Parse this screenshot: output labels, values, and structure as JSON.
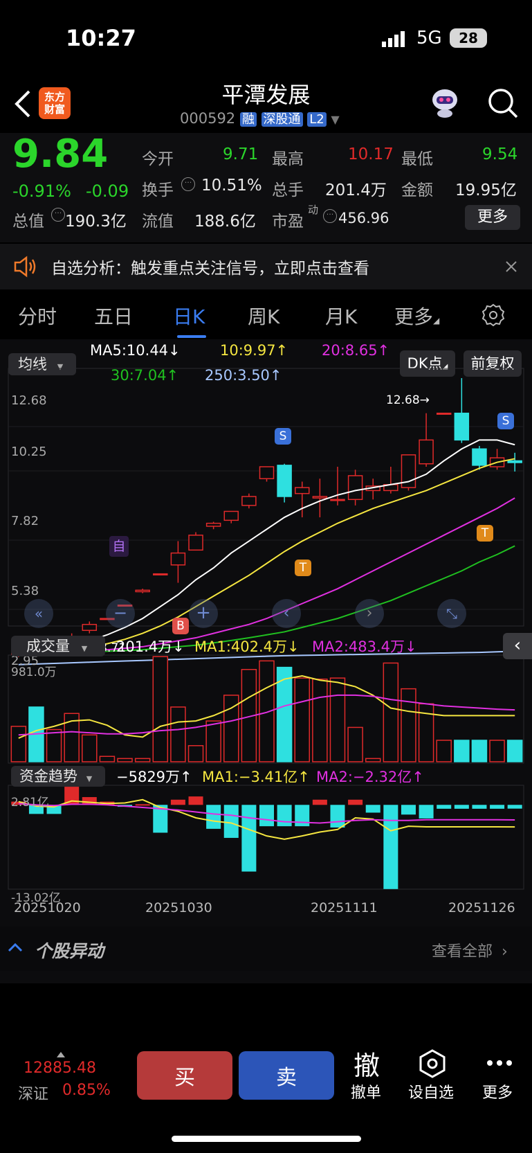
{
  "status_bar": {
    "time": "10:27",
    "network": "5G",
    "battery": "28"
  },
  "header": {
    "app_logo": "东方财富",
    "stock_name": "平潭发展",
    "stock_code": "000592",
    "tags": [
      "融",
      "深股通",
      "L2"
    ]
  },
  "quote": {
    "price": "9.84",
    "change_pct": "-0.91%",
    "change": "-0.09",
    "open_label": "今开",
    "open": "9.71",
    "high_label": "最高",
    "high": "10.17",
    "low_label": "最低",
    "low": "9.54",
    "turnover_label": "换手",
    "turnover": "10.51%",
    "volume_label": "总手",
    "volume": "201.4万",
    "amount_label": "金额",
    "amount": "19.95亿",
    "mktcap_label": "总值",
    "mktcap": "190.3亿",
    "float_label": "流值",
    "float": "188.6亿",
    "pe_label": "市盈",
    "pe_sup": "动",
    "pe": "456.96",
    "more_button": "更多"
  },
  "notice": {
    "text": "自选分析：触发重点关注信号，立即点击查看"
  },
  "tabs": {
    "items": [
      "分时",
      "五日",
      "日K",
      "周K",
      "月K",
      "更多"
    ],
    "active": 2
  },
  "ma_legend": {
    "selector": "均线",
    "ma5": "MA5:10.44↓",
    "ma10": "10:9.97↑",
    "ma20": "20:8.65↑",
    "ma30": "30:7.04↑",
    "ma250": "250:3.50↑",
    "dk_button": "DK点",
    "adjust_button": "前复权"
  },
  "colors": {
    "up": "#e02a2a",
    "down": "#2ee0e0",
    "ma5": "#ffffff",
    "ma10": "#f5e640",
    "ma20": "#e030e0",
    "ma30": "#20c020",
    "ma250": "#a8c8ff",
    "green_text": "#2bd52b"
  },
  "kline": {
    "y_ticks": [
      "12.68",
      "10.25",
      "7.82",
      "5.38",
      "2.95"
    ],
    "max_label": "12.68→",
    "min_label": "←3.71",
    "markers": {
      "zi": "自",
      "s": "S",
      "t": "T",
      "b": "B"
    },
    "candles": [
      {
        "o": 3.4,
        "c": 3.7,
        "h": 3.8,
        "l": 3.3
      },
      {
        "o": 3.6,
        "c": 3.5,
        "h": 3.75,
        "l": 3.4
      },
      {
        "o": 3.5,
        "c": 3.8,
        "h": 3.9,
        "l": 3.45
      },
      {
        "o": 3.8,
        "c": 4.0,
        "h": 4.1,
        "l": 3.75
      },
      {
        "o": 4.2,
        "c": 4.4,
        "h": 4.5,
        "l": 4.1
      },
      {
        "o": 4.6,
        "c": 4.6,
        "h": 4.6,
        "l": 4.6
      },
      {
        "o": 5.05,
        "c": 5.05,
        "h": 5.05,
        "l": 5.05
      },
      {
        "o": 5.5,
        "c": 5.55,
        "h": 5.6,
        "l": 5.45
      },
      {
        "o": 6.1,
        "c": 6.1,
        "h": 6.1,
        "l": 6.1
      },
      {
        "o": 6.4,
        "c": 6.8,
        "h": 7.2,
        "l": 5.8
      },
      {
        "o": 6.9,
        "c": 7.4,
        "h": 7.5,
        "l": 6.9
      },
      {
        "o": 7.7,
        "c": 7.8,
        "h": 7.85,
        "l": 7.6
      },
      {
        "o": 7.9,
        "c": 8.2,
        "h": 8.2,
        "l": 7.8
      },
      {
        "o": 8.4,
        "c": 8.7,
        "h": 8.8,
        "l": 8.3
      },
      {
        "o": 9.3,
        "c": 9.7,
        "h": 9.7,
        "l": 9.2
      },
      {
        "o": 9.75,
        "c": 8.7,
        "h": 9.8,
        "l": 8.5
      },
      {
        "o": 8.8,
        "c": 9.0,
        "h": 9.2,
        "l": 8.0
      },
      {
        "o": 8.65,
        "c": 8.7,
        "h": 9.3,
        "l": 8.0
      },
      {
        "o": 8.6,
        "c": 8.6,
        "h": 9.7,
        "l": 8.4
      },
      {
        "o": 8.6,
        "c": 9.4,
        "h": 9.6,
        "l": 8.4
      },
      {
        "o": 8.9,
        "c": 9.05,
        "h": 9.3,
        "l": 8.6
      },
      {
        "o": 8.9,
        "c": 9.1,
        "h": 9.7,
        "l": 8.8
      },
      {
        "o": 9.0,
        "c": 10.1,
        "h": 10.1,
        "l": 8.9
      },
      {
        "o": 9.8,
        "c": 10.6,
        "h": 11.5,
        "l": 9.7
      },
      {
        "o": 11.5,
        "c": 11.5,
        "h": 11.5,
        "l": 11.5
      },
      {
        "o": 11.5,
        "c": 10.6,
        "h": 12.68,
        "l": 10.5
      },
      {
        "o": 10.3,
        "c": 9.75,
        "h": 10.4,
        "l": 9.6
      },
      {
        "o": 9.7,
        "c": 10.0,
        "h": 10.3,
        "l": 9.6
      },
      {
        "o": 9.9,
        "c": 9.84,
        "h": 10.17,
        "l": 9.54
      }
    ],
    "ma5": [
      3.5,
      3.55,
      3.6,
      3.7,
      3.85,
      4.05,
      4.3,
      4.6,
      5.0,
      5.4,
      5.9,
      6.3,
      6.8,
      7.2,
      7.6,
      8.0,
      8.3,
      8.55,
      8.75,
      8.9,
      9.0,
      9.1,
      9.2,
      9.45,
      9.9,
      10.3,
      10.6,
      10.6,
      10.44
    ],
    "ma10": [
      3.45,
      3.5,
      3.52,
      3.58,
      3.65,
      3.75,
      3.9,
      4.1,
      4.35,
      4.65,
      5.0,
      5.35,
      5.7,
      6.05,
      6.45,
      6.85,
      7.2,
      7.5,
      7.8,
      8.05,
      8.3,
      8.5,
      8.7,
      8.9,
      9.15,
      9.4,
      9.65,
      9.85,
      9.97
    ],
    "ma20": [
      3.4,
      3.42,
      3.45,
      3.48,
      3.5,
      3.55,
      3.6,
      3.65,
      3.75,
      3.85,
      3.95,
      4.1,
      4.25,
      4.4,
      4.6,
      4.85,
      5.1,
      5.35,
      5.6,
      5.9,
      6.2,
      6.5,
      6.8,
      7.1,
      7.4,
      7.7,
      8.0,
      8.3,
      8.65
    ],
    "ma30": [
      3.4,
      3.42,
      3.44,
      3.46,
      3.48,
      3.5,
      3.52,
      3.55,
      3.6,
      3.65,
      3.7,
      3.78,
      3.86,
      3.95,
      4.05,
      4.15,
      4.3,
      4.45,
      4.6,
      4.8,
      5.0,
      5.2,
      5.45,
      5.7,
      5.95,
      6.2,
      6.5,
      6.75,
      7.04
    ],
    "ma250": [
      3.05,
      3.07,
      3.09,
      3.11,
      3.13,
      3.15,
      3.17,
      3.19,
      3.21,
      3.23,
      3.25,
      3.27,
      3.29,
      3.31,
      3.33,
      3.35,
      3.36,
      3.37,
      3.38,
      3.39,
      3.4,
      3.41,
      3.42,
      3.43,
      3.44,
      3.45,
      3.46,
      3.48,
      3.5
    ],
    "range": [
      2.95,
      12.68
    ]
  },
  "volume": {
    "selector": "成交量",
    "current": "201.4万↓",
    "ma1": "MA1:402.4万↓",
    "ma2": "MA2:483.4万↓",
    "top_label": "981.0万",
    "bars": [
      330,
      510,
      300,
      450,
      250,
      50,
      30,
      30,
      980,
      510,
      150,
      380,
      620,
      860,
      940,
      880,
      780,
      770,
      780,
      320,
      30,
      920,
      680,
      540,
      200,
      200,
      200,
      200,
      200
    ],
    "ma1_line": [
      220,
      290,
      330,
      380,
      390,
      340,
      250,
      230,
      330,
      370,
      380,
      430,
      500,
      600,
      690,
      770,
      800,
      760,
      740,
      700,
      620,
      500,
      470,
      450,
      430,
      430,
      430,
      430,
      430
    ],
    "ma2_line": [
      250,
      260,
      270,
      280,
      270,
      260,
      260,
      270,
      290,
      300,
      320,
      350,
      380,
      420,
      460,
      520,
      560,
      600,
      620,
      620,
      610,
      580,
      560,
      540,
      520,
      510,
      500,
      490,
      483
    ]
  },
  "fund": {
    "selector": "资金趋势",
    "current": "−5829万↑",
    "ma1": "MA1:−3.41亿↑",
    "ma2": "MA2:−2.32亿↑",
    "top_label": "2.81亿",
    "bottom_label": "-13.02亿",
    "bars": [
      0.5,
      -1.4,
      -1.4,
      2.8,
      1.2,
      0.5,
      -0.3,
      0.1,
      -4.3,
      0.8,
      1.3,
      -3.7,
      -5.1,
      -10.3,
      -3.3,
      -3.3,
      -3.3,
      0.8,
      -3.5,
      0.8,
      -1.2,
      -13.0,
      -1.5,
      -2.1,
      -0.6,
      -0.6,
      -0.6,
      -0.6,
      -0.58
    ],
    "ma1_line": [
      0.5,
      -0.2,
      -0.3,
      0.6,
      0.4,
      0.2,
      0.3,
      0.8,
      -0.4,
      -1.0,
      -2.0,
      -2.5,
      -2.8,
      -3.8,
      -4.8,
      -5.3,
      -4.8,
      -4.2,
      -3.8,
      -2.0,
      -2.2,
      -4.0,
      -3.3,
      -3.4,
      -3.4,
      -3.4,
      -3.4,
      -3.4,
      -3.41
    ],
    "ma2_line": [
      0.2,
      0.0,
      -0.1,
      0.1,
      0.1,
      0.0,
      -0.2,
      -0.4,
      -0.6,
      -0.8,
      -1.1,
      -1.4,
      -1.6,
      -2.0,
      -2.3,
      -2.6,
      -2.7,
      -2.8,
      -2.6,
      -2.4,
      -2.3,
      -2.4,
      -2.4,
      -2.3,
      -2.3,
      -2.3,
      -2.3,
      -2.3,
      -2.32
    ]
  },
  "dates": [
    "20251020",
    "20251030",
    "20251111",
    "20251126"
  ],
  "stock_move": {
    "title": "个股异动",
    "link": "查看全部"
  },
  "bottom": {
    "index_value": "12885.48",
    "index_name": "深证",
    "index_change": "0.85%",
    "buy": "买",
    "sell": "卖",
    "cancel_icon_char": "撤",
    "cancel": "撤单",
    "watch": "设自选",
    "more": "更多"
  }
}
